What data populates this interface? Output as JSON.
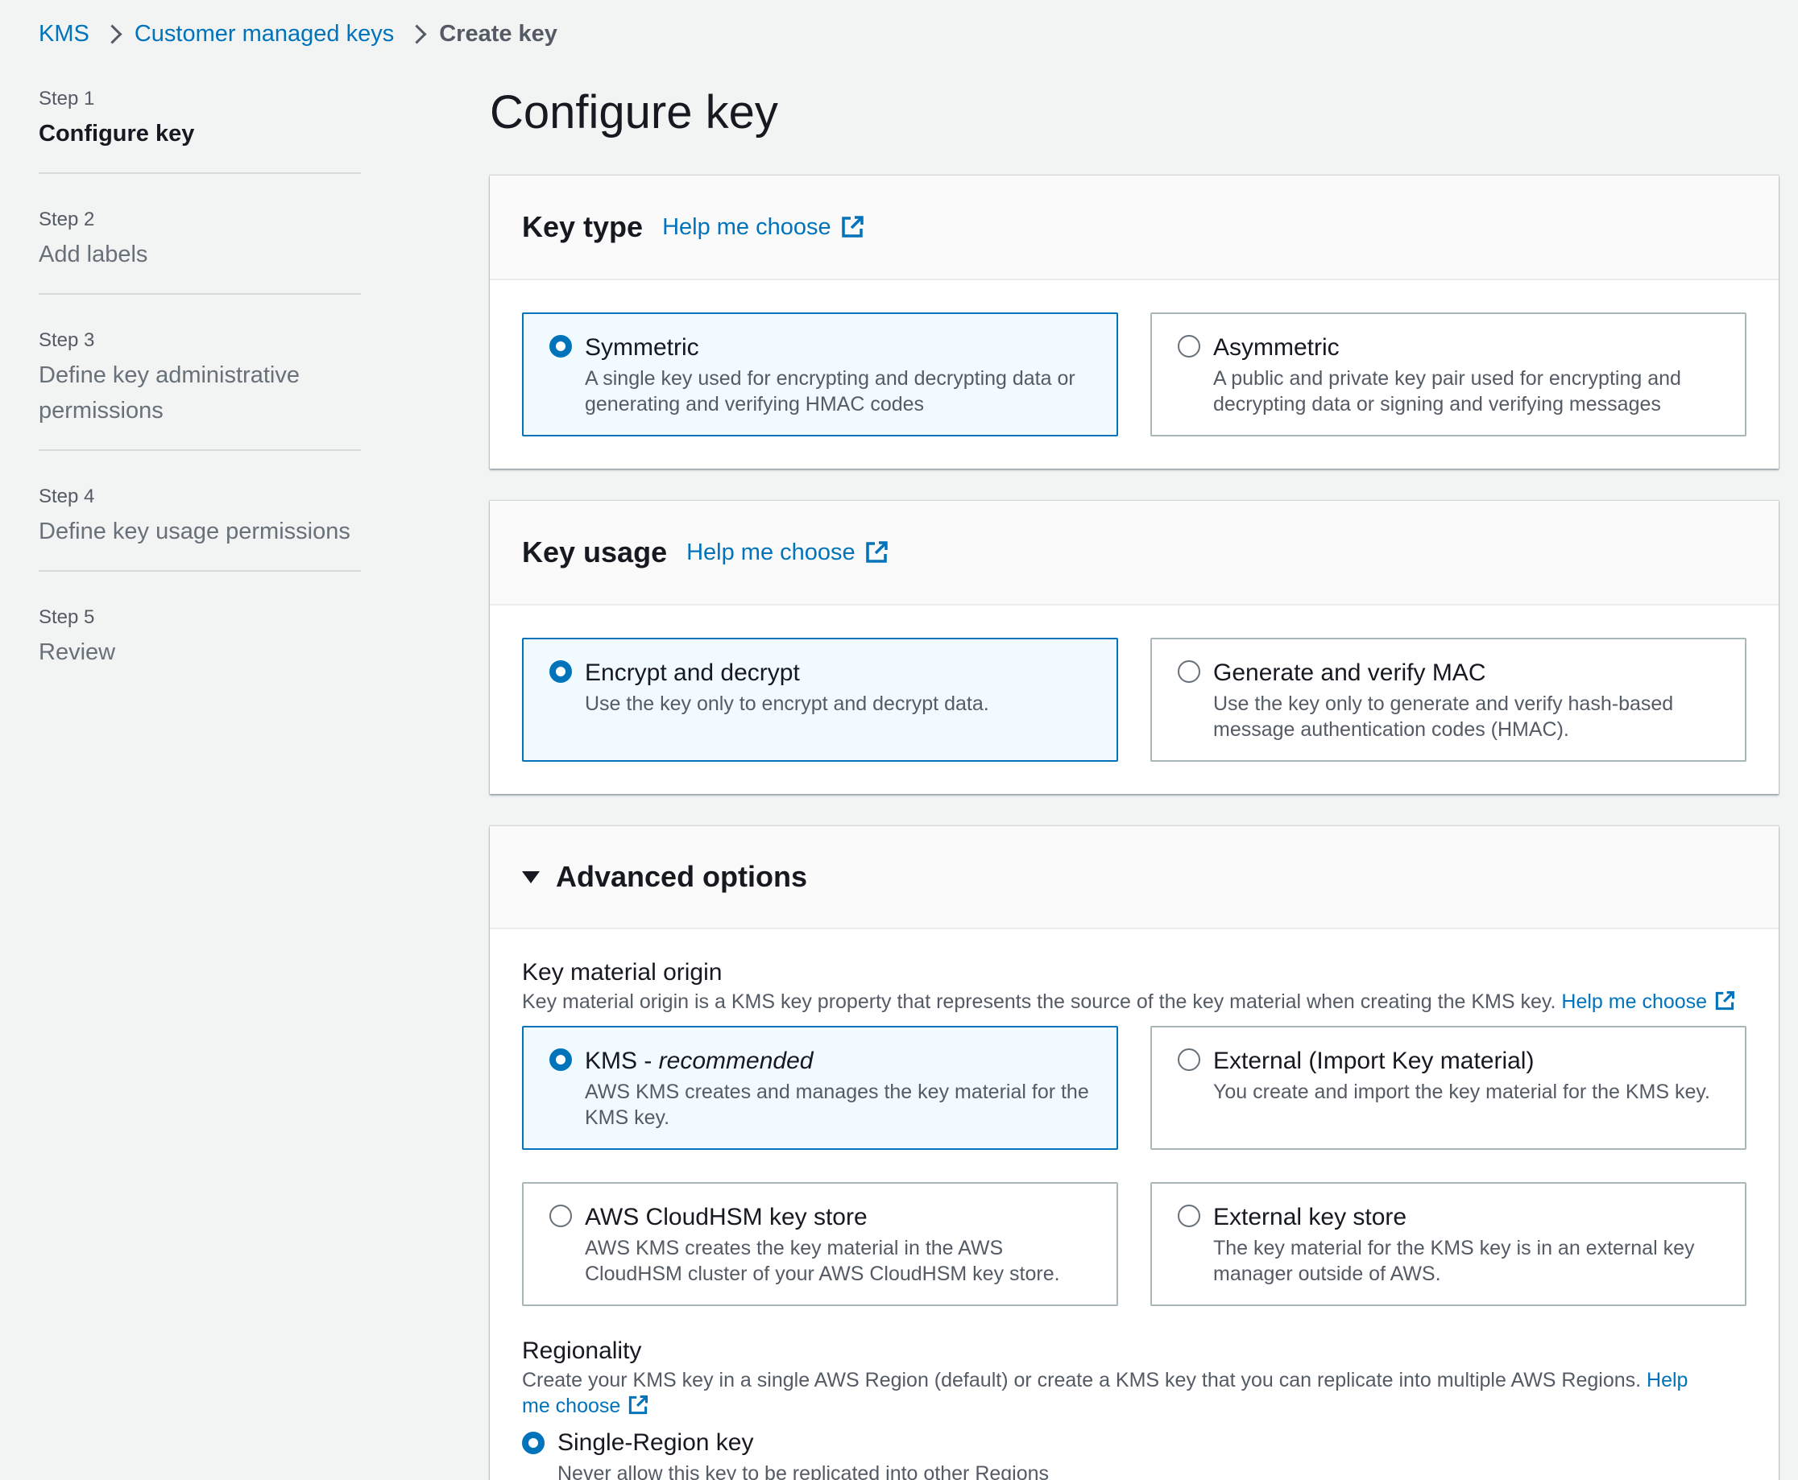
{
  "breadcrumb": {
    "items": [
      "KMS",
      "Customer managed keys",
      "Create key"
    ]
  },
  "steps": [
    {
      "num": "Step 1",
      "title": "Configure key"
    },
    {
      "num": "Step 2",
      "title": "Add labels"
    },
    {
      "num": "Step 3",
      "title": "Define key administrative permissions"
    },
    {
      "num": "Step 4",
      "title": "Define key usage permissions"
    },
    {
      "num": "Step 5",
      "title": "Review"
    }
  ],
  "page_title": "Configure key",
  "key_type": {
    "title": "Key type",
    "help": "Help me choose",
    "options": [
      {
        "label": "Symmetric",
        "desc": "A single key used for encrypting and decrypting data or generating and verifying HMAC codes",
        "selected": true
      },
      {
        "label": "Asymmetric",
        "desc": "A public and private key pair used for encrypting and decrypting data or signing and verifying messages",
        "selected": false
      }
    ]
  },
  "key_usage": {
    "title": "Key usage",
    "help": "Help me choose",
    "options": [
      {
        "label": "Encrypt and decrypt",
        "desc": "Use the key only to encrypt and decrypt data.",
        "selected": true
      },
      {
        "label": "Generate and verify MAC",
        "desc": "Use the key only to generate and verify hash-based message authentication codes (HMAC).",
        "selected": false
      }
    ]
  },
  "advanced": {
    "title": "Advanced options",
    "origin": {
      "label": "Key material origin",
      "desc": "Key material origin is a KMS key property that represents the source of the key material when creating the KMS key.",
      "help": "Help me choose",
      "options": [
        {
          "label_main": "KMS - ",
          "label_em": "recommended",
          "desc": "AWS KMS creates and manages the key material for the KMS key.",
          "selected": true
        },
        {
          "label": "External (Import Key material)",
          "desc": "You create and import the key material for the KMS key.",
          "selected": false
        },
        {
          "label": "AWS CloudHSM key store",
          "desc": "AWS KMS creates the key material in the AWS CloudHSM cluster of your AWS CloudHSM key store.",
          "selected": false
        },
        {
          "label": "External key store",
          "desc": "The key material for the KMS key is in an external key manager outside of AWS.",
          "selected": false
        }
      ]
    },
    "regionality": {
      "label": "Regionality",
      "desc": "Create your KMS key in a single AWS Region (default) or create a KMS key that you can replicate into multiple AWS Regions.",
      "help": "Help me choose",
      "options": [
        {
          "label": "Single-Region key",
          "desc": "Never allow this key to be replicated into other Regions",
          "selected": true
        }
      ]
    }
  },
  "colors": {
    "link": "#0073bb",
    "selected_bg": "#f1faff",
    "page_bg": "#f2f3f3"
  }
}
